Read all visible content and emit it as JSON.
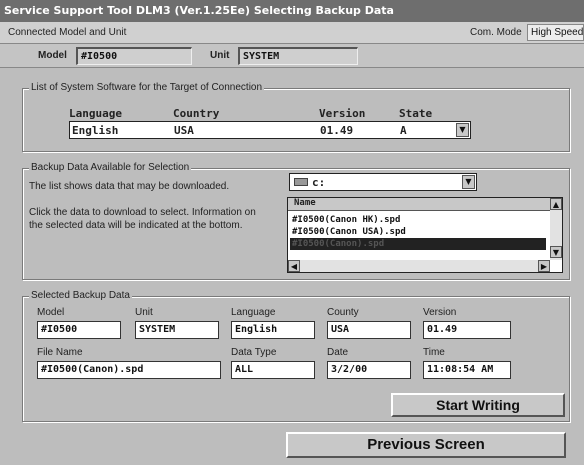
{
  "window": {
    "title": "Service Support Tool DLM3 (Ver.1.25Ee) Selecting Backup Data"
  },
  "connected": {
    "label": "Connected Model and Unit",
    "com_mode_label": "Com. Mode",
    "com_mode_value": "High Speed",
    "model_label": "Model",
    "model_value": "#I0500",
    "unit_label": "Unit",
    "unit_value": "SYSTEM"
  },
  "system_software": {
    "title": "List of System Software for the Target of Connection",
    "headers": {
      "language": "Language",
      "country": "Country",
      "version": "Version",
      "state": "State"
    },
    "row": {
      "language": "English",
      "country": "USA",
      "version": "01.49",
      "state": "A"
    }
  },
  "backup_available": {
    "title": "Backup Data Available for Selection",
    "desc1": "The list shows data that may be downloaded.",
    "desc2": "Click the data to download to select. Information on",
    "desc3": "the selected data will be indicated at the bottom.",
    "drive": "c:",
    "list_header": "Name",
    "items": [
      "#I0500(Canon HK).spd",
      "#I0500(Canon USA).spd",
      "#I0500(Canon).spd"
    ]
  },
  "selected": {
    "title": "Selected Backup Data",
    "model_label": "Model",
    "model_value": "#I0500",
    "unit_label": "Unit",
    "unit_value": "SYSTEM",
    "language_label": "Language",
    "language_value": "English",
    "country_label": "County",
    "country_value": "USA",
    "version_label": "Version",
    "version_value": "01.49",
    "filename_label": "File Name",
    "filename_value": "#I0500(Canon).spd",
    "datatype_label": "Data Type",
    "datatype_value": "ALL",
    "date_label": "Date",
    "date_value": "3/2/00",
    "time_label": "Time",
    "time_value": "11:08:54 AM"
  },
  "buttons": {
    "start_writing": "Start Writing",
    "previous_screen": "Previous Screen"
  }
}
